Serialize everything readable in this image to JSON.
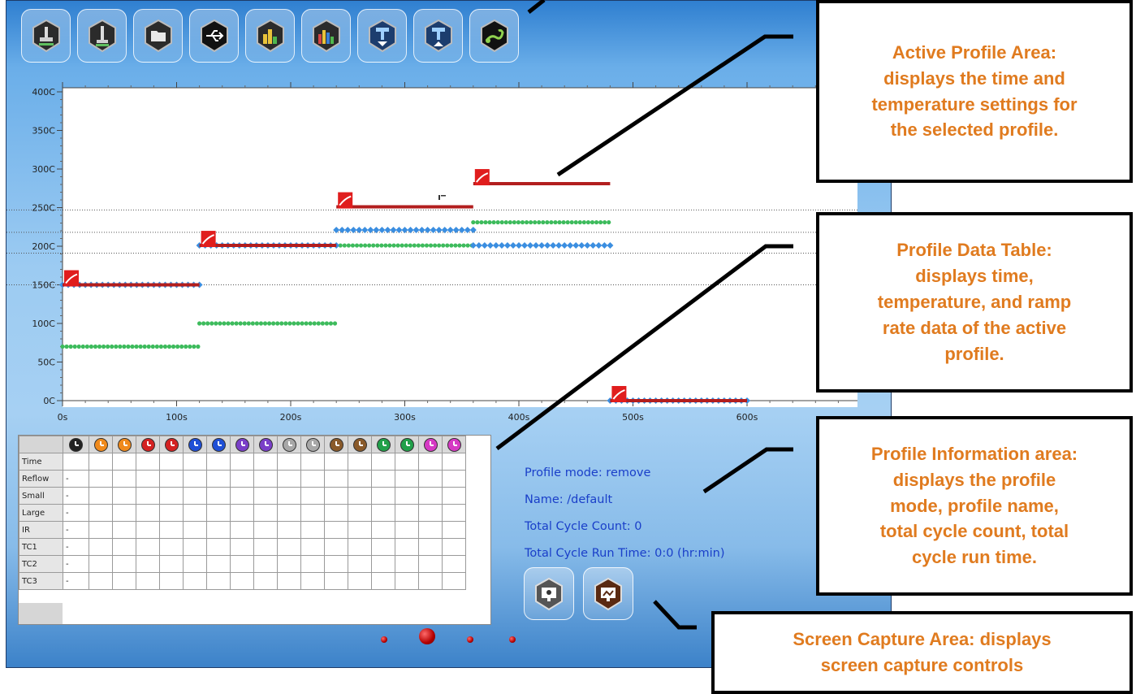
{
  "toolbar": {
    "buttons": [
      {
        "icon": "heater-nozzle-icon"
      },
      {
        "icon": "nozzle-icon"
      },
      {
        "icon": "folder-icon"
      },
      {
        "icon": "usb-icon"
      },
      {
        "icon": "bar-chart-icon"
      },
      {
        "icon": "multi-bar-chart-icon"
      },
      {
        "icon": "blue-nozzle-down-icon"
      },
      {
        "icon": "blue-nozzle-up-icon"
      },
      {
        "icon": "scorpion-icon"
      }
    ]
  },
  "chart_data": {
    "type": "scatter",
    "y_tick_labels": [
      "400C",
      "350C",
      "300C",
      "250C",
      "200C",
      "150C",
      "100C",
      "50C",
      "0C"
    ],
    "x_tick_labels": [
      "0s",
      "100s",
      "200s",
      "300s",
      "400s",
      "500s",
      "600s"
    ],
    "ylim": [
      0,
      400
    ],
    "xlim": [
      0,
      700
    ],
    "grid": "dotted horizontal reference lines",
    "colors": {
      "profile": "#b21e1e",
      "blue_series": "#3b8ee0",
      "green_series": "#3dbb5c",
      "marker": "#e01d1d"
    },
    "reference_lines": [
      247,
      218,
      191,
      150
    ],
    "profile_segments": [
      {
        "x": [
          0,
          120
        ],
        "y": 150
      },
      {
        "x": [
          120,
          240
        ],
        "y": 201
      },
      {
        "x": [
          240,
          360
        ],
        "y": 251
      },
      {
        "x": [
          360,
          480
        ],
        "y": 281
      },
      {
        "x": [
          480,
          600
        ],
        "y": 0
      }
    ],
    "blue_series": [
      {
        "x": [
          0,
          120
        ],
        "y": 150
      },
      {
        "x": [
          120,
          240
        ],
        "y": 201
      },
      {
        "x": [
          240,
          360
        ],
        "y": 221
      },
      {
        "x": [
          360,
          480
        ],
        "y": 201
      },
      {
        "x": [
          480,
          600
        ],
        "y": 0
      }
    ],
    "green_series": [
      {
        "x": [
          0,
          120
        ],
        "y": 70
      },
      {
        "x": [
          120,
          240
        ],
        "y": 100
      },
      {
        "x": [
          240,
          360
        ],
        "y": 201
      },
      {
        "x": [
          360,
          480
        ],
        "y": 231
      }
    ]
  },
  "table": {
    "row_labels": [
      "Time",
      "Reflow",
      "Small",
      "Large",
      "IR",
      "TC1",
      "TC2",
      "TC3"
    ],
    "first_column_values": [
      "",
      "-",
      "-",
      "-",
      "-",
      "-",
      "-",
      "-"
    ],
    "clock_colors": [
      "#222222",
      "#f08a1c",
      "#f08a1c",
      "#d42222",
      "#d42222",
      "#1f4fd6",
      "#1f4fd6",
      "#7a3fc8",
      "#7a3fc8",
      "#a8a8a8",
      "#a8a8a8",
      "#8a5a2a",
      "#8a5a2a",
      "#21a04a",
      "#21a04a",
      "#d63ac4",
      "#d63ac4"
    ]
  },
  "profile_info": {
    "mode": "Profile mode: remove",
    "name": "Name: /default",
    "cycle_count": "Total Cycle Count: 0",
    "run_time": "Total Cycle Run Time: 0:0 (hr:min)"
  },
  "screen_capture": {
    "buttons": [
      {
        "icon": "screen-capture-gray-icon"
      },
      {
        "icon": "screen-capture-brown-icon"
      }
    ]
  },
  "callouts": {
    "active_profile": [
      "Active Profile Area:",
      "displays the time and",
      "temperature settings for",
      "the selected profile."
    ],
    "data_table": [
      "Profile Data Table:",
      "displays time,",
      "temperature, and ramp",
      "rate data of the active",
      "profile."
    ],
    "profile_info": [
      "Profile Information area:",
      "displays the profile",
      "mode, profile name,",
      "total cycle count, total",
      "cycle run time."
    ],
    "screen_capture": [
      "Screen Capture Area: displays",
      "screen capture controls"
    ]
  }
}
